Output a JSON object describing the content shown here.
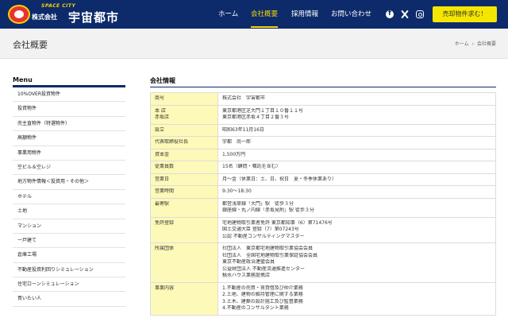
{
  "header": {
    "logo_sub": "SPACE CITY",
    "logo_small": "株式会社",
    "logo_main": "宇宙都市",
    "nav": [
      "ホーム",
      "会社概要",
      "採用情報",
      "お問い合わせ"
    ],
    "active_nav": "会社概要",
    "sell_button": "売却物件求む！",
    "accent_color": "#f4d20a",
    "bg_color": "#0d2b6b"
  },
  "titlebar": {
    "title": "会社概要",
    "breadcrumb": [
      "ホーム",
      "会社概要"
    ],
    "breadcrumb_sep": "›"
  },
  "sidebar": {
    "title": "Menu",
    "items": [
      "10%OVER投資物件",
      "投資物件",
      "売主直物件（特選物件）",
      "高額物件",
      "事業用物件",
      "空ビル＆空レジ",
      "地方物件情報＜投資用・その他＞",
      "ホテル",
      "土地",
      "マンション",
      "一戸建て",
      "倉庫工場",
      "不動産投資利回りシミュレーション",
      "住宅ローンシミュレーション",
      "買いたい人"
    ]
  },
  "main": {
    "section_title": "会社情報",
    "rows": [
      {
        "key": [
          "商号"
        ],
        "value": [
          "株式会社　宇宙都市"
        ]
      },
      {
        "key": [
          "本 店",
          "赤坂店"
        ],
        "value": [
          "東京都港区芝大門１丁目１０番１１号",
          "東京都港区赤坂４丁目２番３号"
        ]
      },
      {
        "key": [
          "設立"
        ],
        "value": [
          "昭和63年11月16日"
        ]
      },
      {
        "key": [
          "代表取締役社長"
        ],
        "value": [
          "宇都　尚一郎"
        ]
      },
      {
        "key": [
          "資本金"
        ],
        "value": [
          "1,500万円"
        ]
      },
      {
        "key": [
          "従業員数"
        ],
        "value": [
          "15名（顧問・嘱託を含む）"
        ]
      },
      {
        "key": [
          "営業日"
        ],
        "value": [
          "月〜金（休業日：土、日、祝日　夏・冬季休業あり）"
        ]
      },
      {
        "key": [
          "営業時間"
        ],
        "value": [
          "9:30〜18:30"
        ]
      },
      {
        "key": [
          "最寄駅"
        ],
        "value": [
          "都営浅草線「大門」駅　徒歩３分",
          "銀座線・丸ノ内線「赤坂見附」駅 徒歩３分"
        ]
      },
      {
        "key": [
          "免許登録"
        ],
        "value": [
          "宅地建物取引業者免許 東京都知事（6）第71476号",
          "国土交通大臣 登録（7）第07243号",
          "公認 不動産コンサルティングマスター"
        ]
      },
      {
        "key": [
          "所属団体"
        ],
        "value": [
          "社団法人　東京都宅地建物取引業協会会員",
          "社団法人　全国宅地建物取引業保証協会会員",
          "東京不動産政治連盟会員",
          "公益財団法人 不動産流通推進センター",
          "積水ハウス業務提携店"
        ]
      },
      {
        "key": [
          "事業内容"
        ],
        "value": [
          "1.不動産の売買・賃貸借及び仲介業務",
          "2.土地、建物の維持管理に関する業務",
          "3.土木、建築の設計施工及び監督業務",
          "4.不動産のコンサルタント業務"
        ]
      }
    ]
  }
}
